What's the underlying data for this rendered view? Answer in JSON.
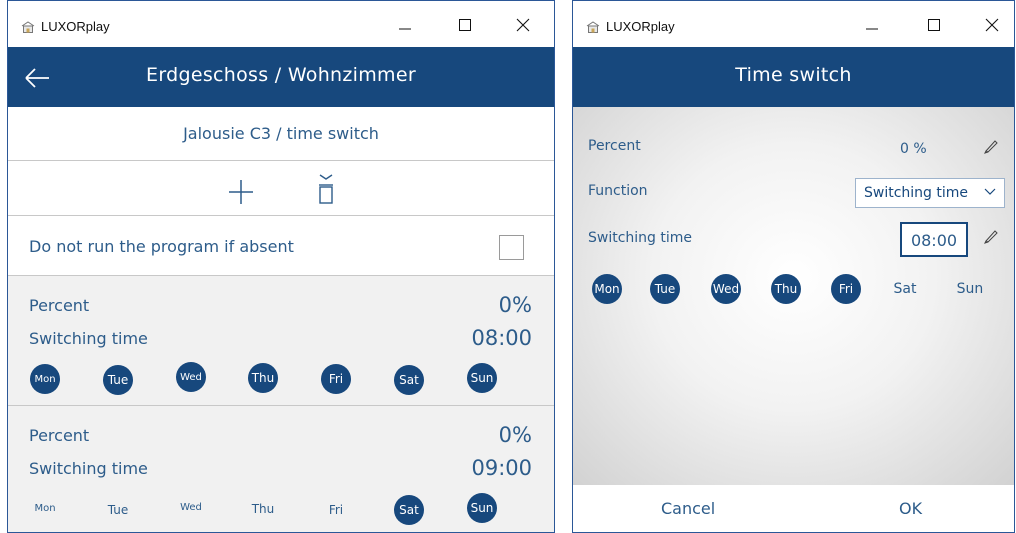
{
  "left_window": {
    "app_title": "LUXORplay",
    "header_title": "Erdgeschoss / Wohnzimmer",
    "subheader": "Jalousie C3 / time switch",
    "absent_label": "Do not run the program if absent",
    "absent_checked": false,
    "entries": [
      {
        "percent_label": "Percent",
        "percent_value": "0%",
        "time_label": "Switching time",
        "time_value": "08:00",
        "days": [
          {
            "label": "Mon",
            "active": true
          },
          {
            "label": "Tue",
            "active": true
          },
          {
            "label": "Wed",
            "active": true
          },
          {
            "label": "Thu",
            "active": true
          },
          {
            "label": "Fri",
            "active": true
          },
          {
            "label": "Sat",
            "active": true
          },
          {
            "label": "Sun",
            "active": true
          }
        ]
      },
      {
        "percent_label": "Percent",
        "percent_value": "0%",
        "time_label": "Switching time",
        "time_value": "09:00",
        "days": [
          {
            "label": "Mon",
            "active": false
          },
          {
            "label": "Tue",
            "active": false
          },
          {
            "label": "Wed",
            "active": false
          },
          {
            "label": "Thu",
            "active": false
          },
          {
            "label": "Fri",
            "active": false
          },
          {
            "label": "Sat",
            "active": true
          },
          {
            "label": "Sun",
            "active": true
          }
        ]
      }
    ]
  },
  "right_window": {
    "app_title": "LUXORplay",
    "header_title": "Time switch",
    "percent_label": "Percent",
    "percent_value": "0 %",
    "function_label": "Function",
    "function_value": "Switching time",
    "time_label": "Switching time",
    "time_value": "08:00",
    "days": [
      {
        "label": "Mon",
        "active": true
      },
      {
        "label": "Tue",
        "active": true
      },
      {
        "label": "Wed",
        "active": true
      },
      {
        "label": "Thu",
        "active": true
      },
      {
        "label": "Fri",
        "active": true
      },
      {
        "label": "Sat",
        "active": false
      },
      {
        "label": "Sun",
        "active": false
      }
    ],
    "cancel_label": "Cancel",
    "ok_label": "OK"
  },
  "colors": {
    "brand_blue": "#17487d",
    "text_blue": "#2d5c8a",
    "window_border": "#2b5797"
  },
  "icons": [
    "home-icon",
    "minimize-icon",
    "maximize-icon",
    "close-icon",
    "back-arrow-icon",
    "plus-icon",
    "delete-icon",
    "pencil-icon",
    "chevron-down-icon"
  ]
}
